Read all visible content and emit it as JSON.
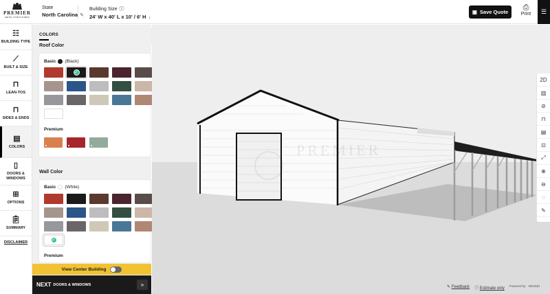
{
  "header": {
    "logo": "PREMIER",
    "logo_sub": "METAL STRUCTURES",
    "state_label": "State",
    "state_value": "North Carolina",
    "size_label": "Building Size",
    "size_value": "24' W x 40' L x 10' / 6' H",
    "save_label": "Save Quote",
    "print_label": "Print"
  },
  "nav": {
    "items": [
      {
        "label": "BUILDING TYPE",
        "icon": "sliders-icon"
      },
      {
        "label": "BUILT & SIZE",
        "icon": "ruler-icon"
      },
      {
        "label": "LEAN-TOS",
        "icon": "lean-to-icon"
      },
      {
        "label": "SIDES & ENDS",
        "icon": "frame-icon"
      },
      {
        "label": "COLORS",
        "icon": "palette-icon"
      },
      {
        "label": "DOORS & WINDOWS",
        "icon": "door-icon"
      },
      {
        "label": "OPTIONS",
        "icon": "options-icon"
      },
      {
        "label": "SUMMARY",
        "icon": "clipboard-icon"
      }
    ],
    "disclaimer": "DISCLAIMER"
  },
  "panel": {
    "title": "COLORS",
    "roof": {
      "title": "Roof Color",
      "basic_label": "Basic",
      "selected": "(Black)",
      "selected_color": "#1a1a1a",
      "basic_colors": [
        "#b03a2e",
        "#1a1a1a",
        "#5a3a2e",
        "#4a2530",
        "#5a4c48",
        "#a6958d",
        "#2a5588",
        "#bdbdbd",
        "#344f42",
        "#cbb6a8",
        "#98979c",
        "#6a6567",
        "#cfc8b6",
        "#4b7796",
        "#b08675",
        "#ffffff"
      ],
      "premium_label": "Premium",
      "premium_colors": [
        "#d9804f",
        "#a7262c",
        "#93ab9a"
      ]
    },
    "wall": {
      "title": "Wall Color",
      "basic_label": "Basic",
      "selected": "(White)",
      "selected_color": "#ffffff",
      "basic_colors": [
        "#b03a2e",
        "#1a1a1a",
        "#5a3a2e",
        "#4a2530",
        "#5a4c48",
        "#a6958d",
        "#2a5588",
        "#bdbdbd",
        "#344f42",
        "#cbb6a8",
        "#98979c",
        "#6a6567",
        "#cfc8b6",
        "#4b7796",
        "#b08675",
        "#ffffff"
      ],
      "premium_label": "Premium"
    }
  },
  "view_center_label": "View Center Building",
  "next": {
    "label": "NEXT",
    "sub": "DOORS & WINDOWS",
    "arrow": "»"
  },
  "tools": [
    "2D",
    "wall-icon",
    "no-wall-icon",
    "door-frame-icon",
    "document-icon",
    "fit-icon",
    "expand-icon",
    "zoom-in-icon",
    "zoom-out-icon",
    "hide-icon",
    "paint-icon"
  ],
  "footer": {
    "feedback": "Feedback",
    "estimate": "Estimate only",
    "powered": "Powered by · SENSEI"
  },
  "watermark": "PREMIER"
}
